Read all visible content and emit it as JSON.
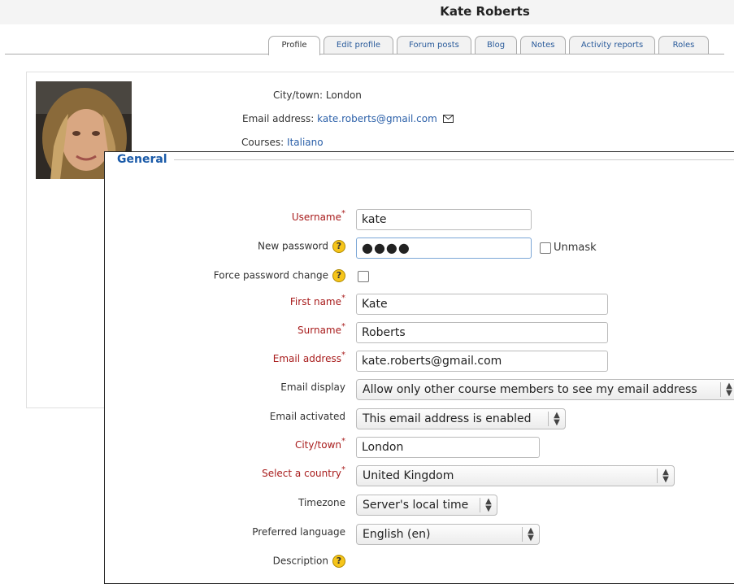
{
  "page": {
    "title": "Kate Roberts"
  },
  "tabs": [
    {
      "label": "Profile"
    },
    {
      "label": "Edit profile"
    },
    {
      "label": "Forum posts"
    },
    {
      "label": "Blog"
    },
    {
      "label": "Notes"
    },
    {
      "label": "Activity reports"
    },
    {
      "label": "Roles"
    }
  ],
  "profile": {
    "city_label": "City/town:",
    "city_value": "London",
    "email_label": "Email address:",
    "email_value": "kate.roberts@gmail.com",
    "courses_label": "Courses:",
    "courses_value": "Italiano"
  },
  "form": {
    "section_title": "General",
    "username": {
      "label": "Username",
      "value": "kate"
    },
    "new_password": {
      "label": "New password",
      "value": "●●●●",
      "unmask_label": "Unmask"
    },
    "force_password_change": {
      "label": "Force password change"
    },
    "first_name": {
      "label": "First name",
      "value": "Kate"
    },
    "surname": {
      "label": "Surname",
      "value": "Roberts"
    },
    "email": {
      "label": "Email address",
      "value": "kate.roberts@gmail.com"
    },
    "email_display": {
      "label": "Email display",
      "value": "Allow only other course members to see my email address"
    },
    "email_activated": {
      "label": "Email activated",
      "value": "This email address is enabled"
    },
    "city": {
      "label": "City/town",
      "value": "London"
    },
    "country": {
      "label": "Select a country",
      "value": "United Kingdom"
    },
    "timezone": {
      "label": "Timezone",
      "value": "Server's local time"
    },
    "language": {
      "label": "Preferred language",
      "value": "English (en)"
    },
    "description": {
      "label": "Description"
    }
  },
  "icons": {
    "help": "?",
    "required": "*",
    "select_arrows": "⌃⌄"
  },
  "colors": {
    "required": "#a81c1c",
    "link": "#2a5fa8",
    "help_icon": "#f6c51a"
  }
}
